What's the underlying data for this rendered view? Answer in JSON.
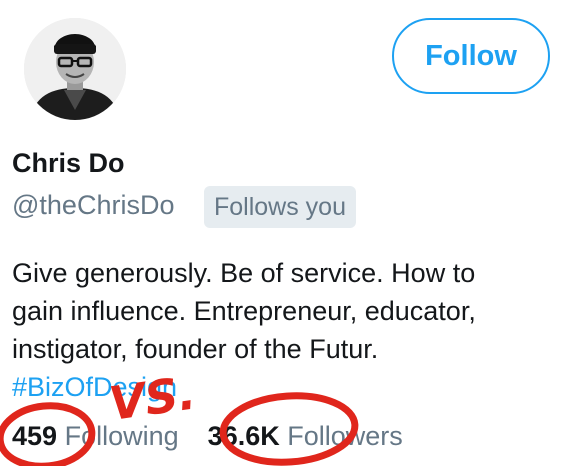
{
  "profile": {
    "name": "Chris Do",
    "handle": "@theChrisDo",
    "follows_you": "Follows you",
    "bio_lines": [
      "Give generously. Be of service. How to",
      "gain influence. Entrepreneur, educator,",
      "instigator, founder of the Futur."
    ],
    "hashtag": "#BizOfDesign"
  },
  "follow_button": {
    "label": "Follow"
  },
  "stats": {
    "following_count": "459",
    "following_label": "Following",
    "followers_count": "36.6K",
    "followers_label": "Followers"
  },
  "annotation": {
    "text": "VS.",
    "color": "#e0261c"
  },
  "colors": {
    "accent": "#1da1f2",
    "text": "#14171a",
    "muted": "#657786",
    "badge_bg": "#e6ecf0"
  }
}
